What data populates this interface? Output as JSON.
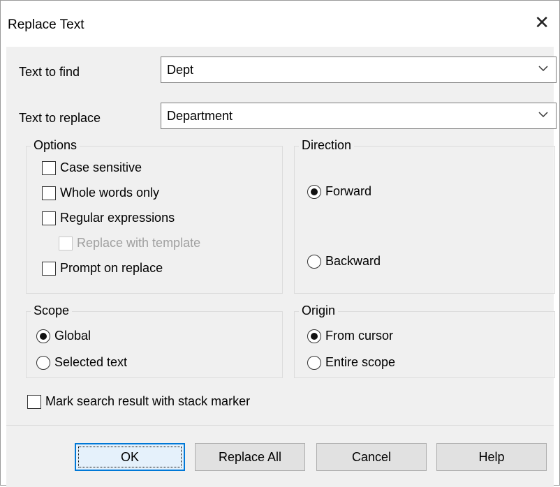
{
  "window": {
    "title": "Replace Text",
    "close_glyph": "✕"
  },
  "find": {
    "label": "Text to find",
    "value": "Dept"
  },
  "replace": {
    "label": "Text to replace",
    "value": "Department"
  },
  "options": {
    "title": "Options",
    "case_sensitive": "Case sensitive",
    "whole_words": "Whole words only",
    "regex": "Regular expressions",
    "template": "Replace with template",
    "prompt": "Prompt on replace"
  },
  "direction": {
    "title": "Direction",
    "forward": "Forward",
    "backward": "Backward"
  },
  "scope": {
    "title": "Scope",
    "global": "Global",
    "selected": "Selected text"
  },
  "origin": {
    "title": "Origin",
    "cursor": "From cursor",
    "entire": "Entire scope"
  },
  "mark_stack": "Mark search result with stack marker",
  "buttons": {
    "ok": "OK",
    "replace_all": "Replace All",
    "cancel": "Cancel",
    "help": "Help"
  }
}
